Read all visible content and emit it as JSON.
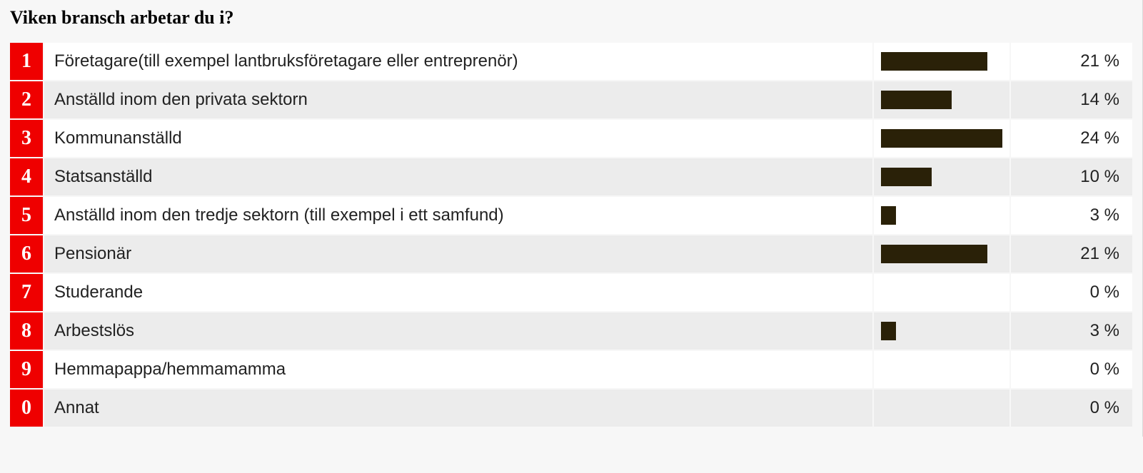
{
  "title": "Viken bransch arbetar du i?",
  "rows": [
    {
      "num": "1",
      "label": "Företagare(till exempel lantbruksföretagare eller entreprenör)",
      "percent": 21,
      "pct_label": "21 %"
    },
    {
      "num": "2",
      "label": "Anställd inom den privata sektorn",
      "percent": 14,
      "pct_label": "14 %"
    },
    {
      "num": "3",
      "label": "Kommunanställd",
      "percent": 24,
      "pct_label": "24 %"
    },
    {
      "num": "4",
      "label": "Statsanställd",
      "percent": 10,
      "pct_label": "10 %"
    },
    {
      "num": "5",
      "label": "Anställd inom den tredje sektorn (till exempel i ett samfund)",
      "percent": 3,
      "pct_label": "3 %"
    },
    {
      "num": "6",
      "label": "Pensionär",
      "percent": 21,
      "pct_label": "21 %"
    },
    {
      "num": "7",
      "label": "Studerande",
      "percent": 0,
      "pct_label": "0 %"
    },
    {
      "num": "8",
      "label": "Arbestslös",
      "percent": 3,
      "pct_label": "3 %"
    },
    {
      "num": "9",
      "label": "Hemmapappa/hemmamamma",
      "percent": 0,
      "pct_label": "0 %"
    },
    {
      "num": "0",
      "label": "Annat",
      "percent": 0,
      "pct_label": "0 %"
    }
  ],
  "chart_data": {
    "type": "bar",
    "title": "Viken bransch arbetar du i?",
    "categories": [
      "Företagare(till exempel lantbruksföretagare eller entreprenör)",
      "Anställd inom den privata sektorn",
      "Kommunanställd",
      "Statsanställd",
      "Anställd inom den tredje sektorn (till exempel i ett samfund)",
      "Pensionär",
      "Studerande",
      "Arbestslös",
      "Hemmapappa/hemmamamma",
      "Annat"
    ],
    "values": [
      21,
      14,
      24,
      10,
      3,
      21,
      0,
      3,
      0,
      0
    ],
    "xlabel": "",
    "ylabel": "%",
    "ylim": [
      0,
      100
    ]
  },
  "colors": {
    "num_bg": "#ef0000",
    "bar_fill": "#2a2108",
    "row_alt": "#ececec"
  }
}
